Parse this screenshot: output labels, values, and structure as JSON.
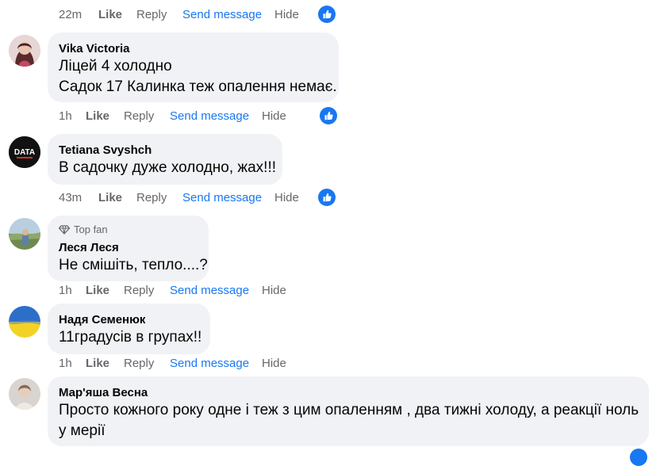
{
  "actions": {
    "like": "Like",
    "reply": "Reply",
    "send": "Send message",
    "hide": "Hide"
  },
  "top_row": {
    "time": "22m"
  },
  "comments": [
    {
      "author": "Vika Victoria",
      "lines": [
        "Ліцей 4 холодно",
        "Садок 17 Калинка теж опалення немає."
      ],
      "time": "1h"
    },
    {
      "author": "Tetiana Svyshch",
      "lines": [
        "В садочку дуже холодно, жах!!!"
      ],
      "time": "43m"
    },
    {
      "author": "Леся Леся",
      "badge": "Top fan",
      "lines": [
        "Не смішіть, тепло....?"
      ],
      "time": "1h"
    },
    {
      "author": "Надя Семенюк",
      "lines": [
        "11градусів в групах!!"
      ],
      "time": "1h"
    },
    {
      "author": "Мар'яша Весна",
      "lines": [
        "Просто кожного року одне і теж з цим опаленням , два тижні холоду, а реакції ноль",
        "у мерії"
      ]
    }
  ],
  "avatar_texts": {
    "data_logo": "DATA"
  },
  "colors": {
    "accent": "#1877f2",
    "bubble": "#f0f2f5",
    "muted": "#65676b"
  }
}
